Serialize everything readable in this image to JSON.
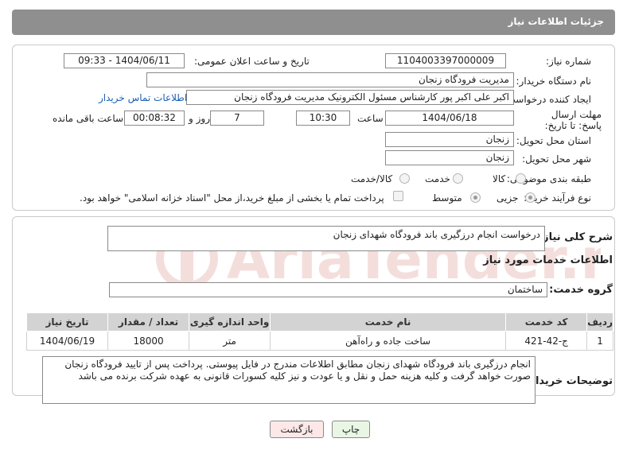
{
  "header": {
    "title": "جزئیات اطلاعات نیاز"
  },
  "fields": {
    "need_number_label": "شماره نیاز:",
    "need_number": "1104003397000009",
    "announce_label": "تاریخ و ساعت اعلان عمومی:",
    "announce_value": "1404/06/11 - 09:33",
    "buyer_org_label": "نام دستگاه خریدار:",
    "buyer_org": "مدیریت فرودگاه زنجان",
    "creator_label": "ایجاد کننده درخواست:",
    "creator": "اکبر علی اکبر پور کارشناس مسئول الکترونیک مدیریت فرودگاه زنجان",
    "contact_link": "اطلاعات تماس خریدار",
    "deadline_label": "مهلت ارسال پاسخ: تا تاریخ:",
    "deadline_date": "1404/06/18",
    "time_label": "ساعت",
    "deadline_time": "10:30",
    "days_value": "7",
    "days_label": "روز و",
    "remaining_time": "00:08:32",
    "remaining_label": "ساعت باقی مانده",
    "province_label": "استان محل تحویل:",
    "province": "زنجان",
    "city_label": "شهر محل تحویل:",
    "city": "زنجان",
    "category_label": "طبقه بندی موضوعی:",
    "category_options": [
      "کالا",
      "خدمت",
      "کالا/خدمت"
    ],
    "category_selected": "خدمت",
    "process_label": "نوع فرآیند خرید :",
    "process_options": [
      "جزیی",
      "متوسط"
    ],
    "process_selected": "جزیی",
    "payment_note": "پرداخت تمام یا بخشی از مبلغ خرید،از محل \"اسناد خزانه اسلامی\" خواهد بود."
  },
  "summary": {
    "label": "شرح کلی نیاز:",
    "value": "درخواست انجام درزگیری باند فرودگاه شهدای زنجان"
  },
  "services_section": {
    "title": "اطلاعات خدمات مورد نیاز",
    "group_label": "گروه خدمت:",
    "group_value": "ساختمان"
  },
  "table": {
    "headers": [
      "ردیف",
      "کد خدمت",
      "نام خدمت",
      "واحد اندازه گیری",
      "تعداد / مقدار",
      "تاریخ نیاز"
    ],
    "rows": [
      [
        "1",
        "ج-42-421",
        "ساخت جاده و راه‌آهن",
        "متر",
        "18000",
        "1404/06/19"
      ]
    ]
  },
  "buyer_notes": {
    "label": "توضیحات خریدار:",
    "value": "انجام درزگیری باند فرودگاه شهدای زنجان مطابق اطلاعات مندرج در فایل پیوستی. پرداخت پس از تایید فرودگاه زنجان صورت خواهد گرفت و کلیه هزینه حمل و نقل و یا عودت و نیز کلیه کسورات قانونی به عهده شرکت برنده می باشد"
  },
  "buttons": {
    "print": "چاپ",
    "back": "بازگشت"
  },
  "watermark": {
    "text": "AriaTender.neT"
  },
  "colors": {
    "header_bg": "#8f8f8f",
    "link": "#1a5fb4",
    "back_btn_bg": "#fde8e8",
    "print_btn_bg": "#e9f6e4",
    "watermark": "#c0392b"
  }
}
